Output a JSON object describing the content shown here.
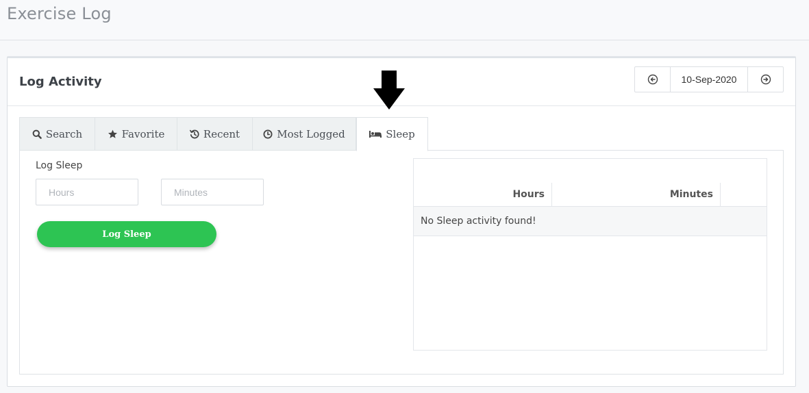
{
  "page": {
    "title": "Exercise Log"
  },
  "card": {
    "title": "Log Activity",
    "date_nav": {
      "prev_icon": "arrow-left-circle-icon",
      "date": "10-Sep-2020",
      "next_icon": "arrow-right-circle-icon"
    }
  },
  "tabs": [
    {
      "label": "Search",
      "icon": "search-icon",
      "active": false
    },
    {
      "label": "Favorite",
      "icon": "star-icon",
      "active": false
    },
    {
      "label": "Recent",
      "icon": "history-icon",
      "active": false
    },
    {
      "label": "Most Logged",
      "icon": "clock-icon",
      "active": false
    },
    {
      "label": "Sleep",
      "icon": "bed-icon",
      "active": true
    }
  ],
  "sleep_form": {
    "label": "Log Sleep",
    "hours_placeholder": "Hours",
    "minutes_placeholder": "Minutes",
    "button_label": "Log Sleep"
  },
  "results": {
    "columns": [
      "Hours",
      "Minutes"
    ],
    "empty_message": "No Sleep activity found!"
  },
  "colors": {
    "accent_green": "#2dc453",
    "indicator_arrow": "#000000"
  }
}
